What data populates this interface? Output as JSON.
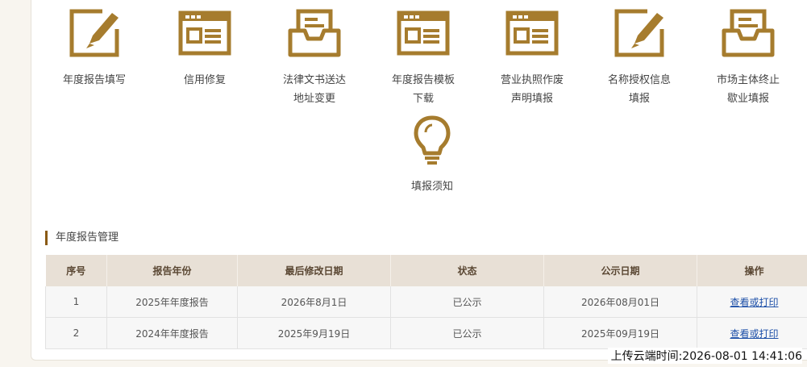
{
  "tiles": [
    {
      "icon": "edit-form-icon",
      "line1": "年度报告填写",
      "line2": ""
    },
    {
      "icon": "web-form-icon",
      "line1": "信用修复",
      "line2": ""
    },
    {
      "icon": "inbox-tray-icon",
      "line1": "法律文书送达",
      "line2": "地址变更"
    },
    {
      "icon": "web-form-icon",
      "line1": "年度报告模板",
      "line2": "下载"
    },
    {
      "icon": "web-form-icon",
      "line1": "营业执照作废",
      "line2": "声明填报"
    },
    {
      "icon": "edit-form-icon",
      "line1": "名称授权信息",
      "line2": "填报"
    },
    {
      "icon": "inbox-tray-icon",
      "line1": "市场主体终止",
      "line2": "歇业填报"
    },
    {
      "icon": "lightbulb-icon",
      "line1": "填报须知",
      "line2": ""
    }
  ],
  "section_title": "年度报告管理",
  "table": {
    "headers": [
      "序号",
      "报告年份",
      "最后修改日期",
      "状态",
      "公示日期",
      "操作"
    ],
    "rows": [
      {
        "index": "1",
        "year": "2025年年度报告",
        "modified": "2026年8月1日",
        "status": "已公示",
        "publish_date": "2026年08月01日",
        "action": "查看或打印"
      },
      {
        "index": "2",
        "year": "2024年年度报告",
        "modified": "2025年9月19日",
        "status": "已公示",
        "publish_date": "2025年09月19日",
        "action": "查看或打印"
      }
    ]
  },
  "upload_time": "上传云端时间:2026-08-01 14:41:06",
  "colors": {
    "icon": "#a67c2e",
    "header_bg": "#e8e0d6",
    "link": "#1c4fa8",
    "accent": "#8a5a14"
  }
}
